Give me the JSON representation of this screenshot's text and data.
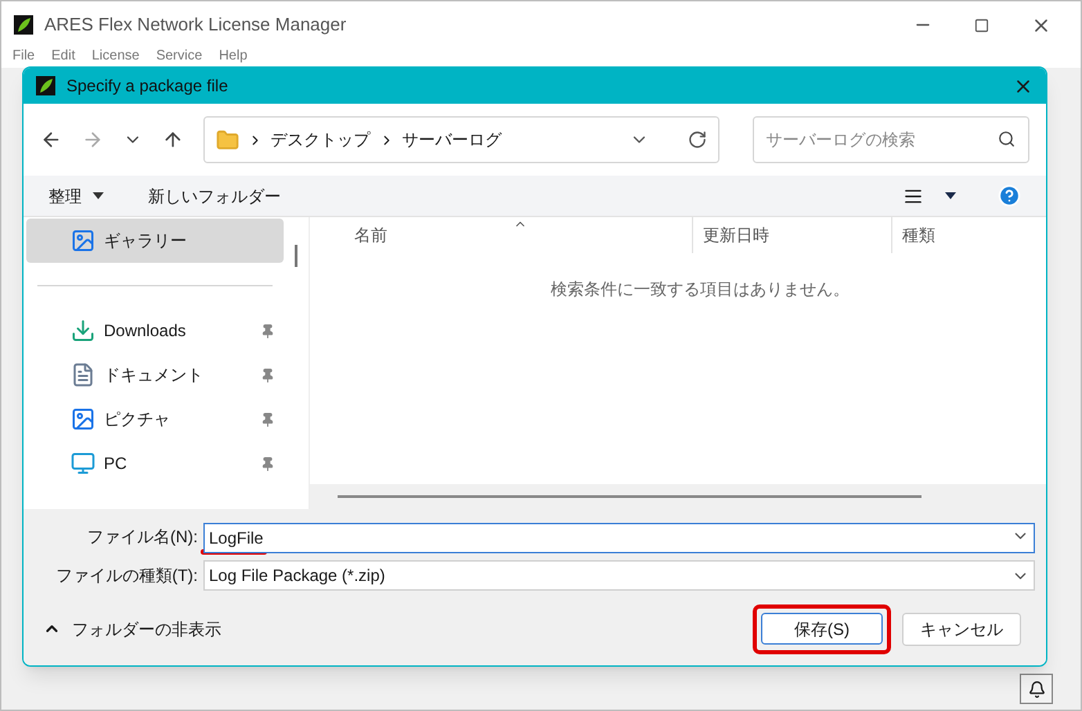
{
  "window": {
    "title": "ARES Flex Network License Manager",
    "menu": [
      "File",
      "Edit",
      "License",
      "Service",
      "Help"
    ]
  },
  "dialog": {
    "title": "Specify a package file",
    "breadcrumb": [
      "デスクトップ",
      "サーバーログ"
    ],
    "search": {
      "placeholder": "サーバーログの検索"
    },
    "toolbar": {
      "organize": "整理",
      "new_folder": "新しいフォルダー"
    },
    "sidebar": {
      "items": [
        {
          "label": "ギャラリー",
          "kind": "gallery",
          "selected": true,
          "pinned": false
        },
        {
          "label": "Downloads",
          "kind": "downloads",
          "selected": false,
          "pinned": true
        },
        {
          "label": "ドキュメント",
          "kind": "documents",
          "selected": false,
          "pinned": true
        },
        {
          "label": "ピクチャ",
          "kind": "pictures",
          "selected": false,
          "pinned": true
        },
        {
          "label": "PC",
          "kind": "pc",
          "selected": false,
          "pinned": true
        }
      ]
    },
    "columns": [
      "名前",
      "更新日時",
      "種類"
    ],
    "empty_message": "検索条件に一致する項目はありません。",
    "file_name": {
      "label": "ファイル名(N):",
      "value": "LogFile"
    },
    "file_type": {
      "label": "ファイルの種類(T):",
      "value": "Log File Package (*.zip)"
    },
    "hide_folders": "フォルダーの非表示",
    "buttons": [
      "保存(S)",
      "キャンセル"
    ]
  }
}
